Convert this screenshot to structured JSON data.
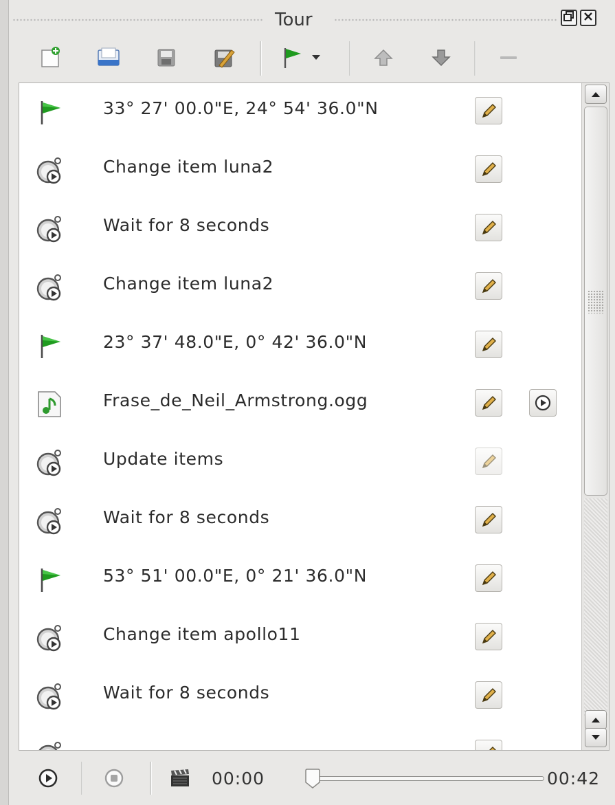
{
  "window": {
    "title": "Tour",
    "float_button": "🗗",
    "close_button": "✕"
  },
  "toolbar": {
    "buttons": [
      {
        "name": "new-tour",
        "icon": "new-document-icon"
      },
      {
        "name": "open-tour",
        "icon": "open-folder-icon"
      },
      {
        "name": "save-tour",
        "icon": "save-icon"
      },
      {
        "name": "save-as",
        "icon": "save-as-icon"
      },
      {
        "name": "add-flyto",
        "icon": "flag-icon"
      },
      {
        "name": "move-up",
        "icon": "arrow-up-icon"
      },
      {
        "name": "move-down",
        "icon": "arrow-down-icon"
      },
      {
        "name": "remove",
        "icon": "minus-icon"
      }
    ]
  },
  "items": [
    {
      "type": "flag",
      "label": "33° 27' 00.0\"E, 24° 54' 36.0\"N",
      "editable": true,
      "playable": false
    },
    {
      "type": "clock",
      "label": "Change item luna2",
      "editable": true,
      "playable": false
    },
    {
      "type": "clock",
      "label": "Wait for 8 seconds",
      "editable": true,
      "playable": false
    },
    {
      "type": "clock",
      "label": "Change item luna2",
      "editable": true,
      "playable": false
    },
    {
      "type": "flag",
      "label": "23° 37' 48.0\"E, 0° 42' 36.0\"N",
      "editable": true,
      "playable": false
    },
    {
      "type": "sound",
      "label": "Frase_de_Neil_Armstrong.ogg",
      "editable": true,
      "playable": true
    },
    {
      "type": "clock",
      "label": "Update items",
      "editable": false,
      "playable": false
    },
    {
      "type": "clock",
      "label": "Wait for 8 seconds",
      "editable": true,
      "playable": false
    },
    {
      "type": "flag",
      "label": "53° 51' 00.0\"E, 0° 21' 36.0\"N",
      "editable": true,
      "playable": false
    },
    {
      "type": "clock",
      "label": "Change item apollo11",
      "editable": true,
      "playable": false
    },
    {
      "type": "clock",
      "label": "Wait for 8 seconds",
      "editable": true,
      "playable": false
    }
  ],
  "playback": {
    "current_time": "00:00",
    "total_time": "00:42",
    "progress": 0
  },
  "colors": {
    "flag_green": "#1f9a1f",
    "accent_blue": "#3a74c8"
  }
}
